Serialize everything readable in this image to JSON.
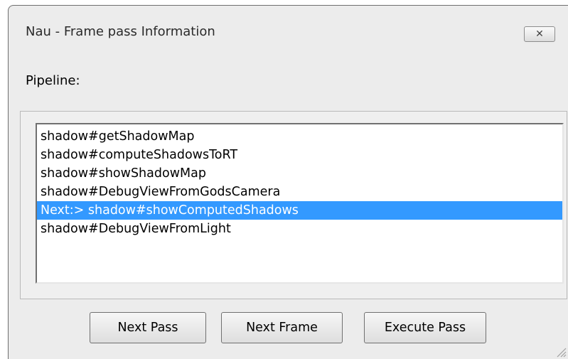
{
  "window": {
    "title": "Nau - Frame pass Information",
    "close_symbol": "✕"
  },
  "pipeline": {
    "label": "Pipeline:",
    "items": [
      "shadow#getShadowMap",
      "shadow#computeShadowsToRT",
      "shadow#showShadowMap",
      "shadow#DebugViewFromGodsCamera",
      "Next:> shadow#showComputedShadows",
      "shadow#DebugViewFromLight"
    ],
    "selected_index": 4
  },
  "buttons": {
    "next_pass": "Next Pass",
    "next_frame": "Next Frame",
    "execute_pass": "Execute Pass"
  },
  "colors": {
    "selection": "#3399ff",
    "window_bg": "#ececec"
  }
}
